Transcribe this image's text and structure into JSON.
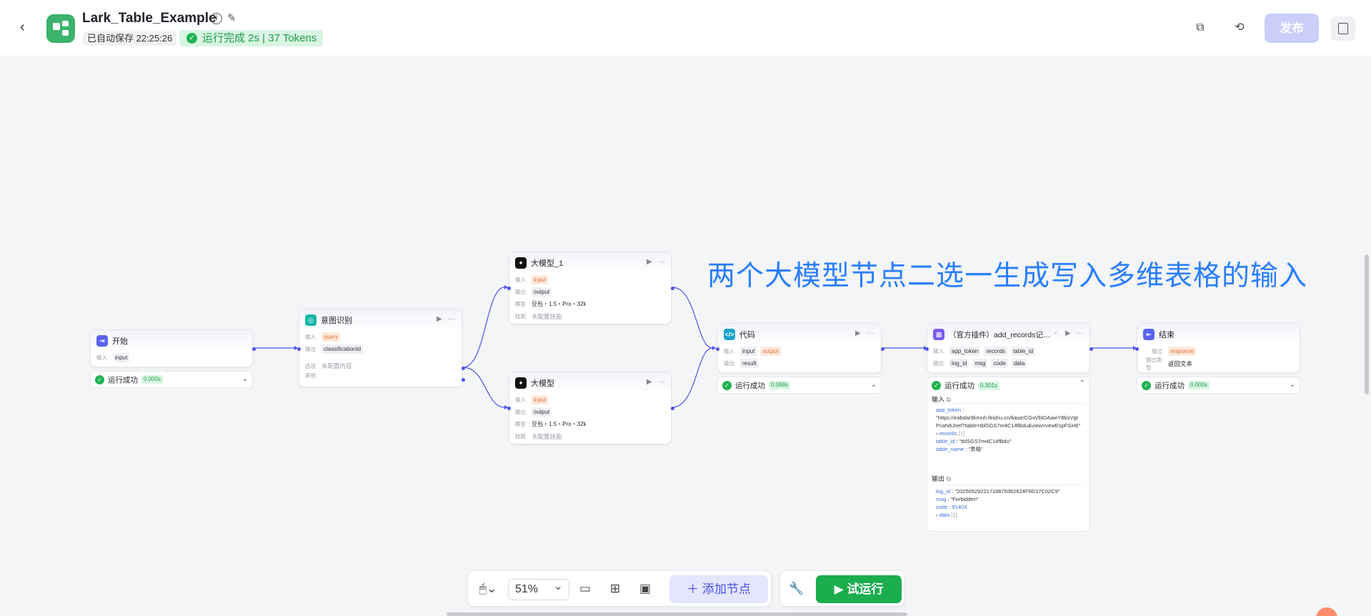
{
  "header": {
    "title": "Lark_Table_Example",
    "saved": "已自动保存 22:25:26",
    "run_status": "运行完成 2s | 37 Tokens",
    "publish_label": "发布"
  },
  "annotation": "两个大模型节点二选一生成写入多维表格的输入",
  "labels": {
    "input": "输入",
    "output": "输出",
    "model": "模型",
    "skills": "技能",
    "options": "选项",
    "other": "其他",
    "output_type": "输出类型",
    "run_success": "运行成功",
    "not_configured_skill": "未配置技能",
    "not_configured_content": "未配置内容"
  },
  "nodes": {
    "start": {
      "title": "开始",
      "inputs": [
        "input"
      ],
      "duration": "0.000s"
    },
    "intent": {
      "title": "意图识别",
      "inputs": [
        "query"
      ],
      "outputs": [
        "classificationId"
      ]
    },
    "llm1": {
      "title": "大模型_1",
      "inputs": [
        "input"
      ],
      "outputs": [
        "output"
      ],
      "model": "豆包・1.5・Pro・32k"
    },
    "llm2": {
      "title": "大模型",
      "inputs": [
        "input"
      ],
      "outputs": [
        "output"
      ],
      "model": "豆包・1.5・Pro・32k"
    },
    "code": {
      "title": "代码",
      "inputs": [
        "input",
        "output"
      ],
      "outputs": [
        "result"
      ],
      "duration": "0.068s"
    },
    "plugin": {
      "title": "（官方插件）add_records记…",
      "inputs": [
        "app_token",
        "records",
        "table_id"
      ],
      "outputs": [
        "log_id",
        "msg",
        "code",
        "data"
      ],
      "duration": "0.301s",
      "input_detail": {
        "app_token_key": "app_token",
        "app_token_val": "\"https://eabdar9kmnh.feishu.cn/base/CGxVbIDAiaeY8bsVgtPcaN6Jnef?table=tblSGS7m4C14fBdu&view=vewEspFGH6\"",
        "records": "records",
        "records_count": "[1]",
        "table_id_key": "table_id",
        "table_id_val": "\"tblSGS7m4C14fBdu\"",
        "table_name_key": "table_name",
        "table_name_val": "\"表格\""
      },
      "output_detail": {
        "log_id_key": "log_id",
        "log_id_val": "\"20250529221718878362624F6D17C02C9\"",
        "msg_key": "msg",
        "msg_val": "\"Forbidden\"",
        "code_key": "code",
        "code_val": "91403",
        "data_key": "data",
        "data_count": "[1]"
      }
    },
    "end": {
      "title": "结束",
      "outputs": [
        "response"
      ],
      "output_type": "返回文本",
      "duration": "0.000s"
    }
  },
  "toolbar": {
    "zoom": "51%",
    "add_node": "添加节点",
    "trial_run": "试运行"
  },
  "colors": {
    "accent": "#4d53e8",
    "success": "#1cad4f",
    "annotation": "#2a7fff"
  }
}
